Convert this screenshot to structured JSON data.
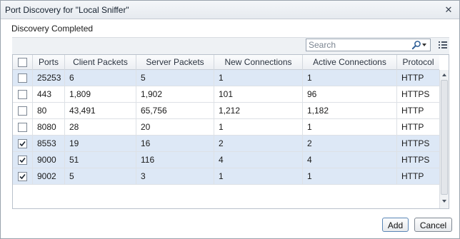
{
  "window": {
    "title": "Port Discovery for \"Local Sniffer\"",
    "close_glyph": "✕"
  },
  "status_text": "Discovery Completed",
  "toolbar": {
    "search_placeholder": "Search"
  },
  "grid": {
    "columns": [
      "Ports",
      "Client Packets",
      "Server Packets",
      "New Connections",
      "Active Connections",
      "Protocol"
    ],
    "header_checked": false,
    "rows": [
      {
        "checked": false,
        "selected": true,
        "cells": [
          "25253",
          "6",
          "5",
          "1",
          "1",
          "HTTP"
        ]
      },
      {
        "checked": false,
        "selected": false,
        "cells": [
          "443",
          "1,809",
          "1,902",
          "101",
          "96",
          "HTTPS"
        ]
      },
      {
        "checked": false,
        "selected": false,
        "cells": [
          "80",
          "43,491",
          "65,756",
          "1,212",
          "1,182",
          "HTTP"
        ]
      },
      {
        "checked": false,
        "selected": false,
        "cells": [
          "8080",
          "28",
          "20",
          "1",
          "1",
          "HTTP"
        ]
      },
      {
        "checked": true,
        "selected": true,
        "cells": [
          "8553",
          "19",
          "16",
          "2",
          "2",
          "HTTPS"
        ]
      },
      {
        "checked": true,
        "selected": true,
        "cells": [
          "9000",
          "51",
          "116",
          "4",
          "4",
          "HTTPS"
        ]
      },
      {
        "checked": true,
        "selected": true,
        "cells": [
          "9002",
          "5",
          "3",
          "1",
          "1",
          "HTTP"
        ]
      }
    ]
  },
  "buttons": {
    "add_label": "Add",
    "cancel_label": "Cancel"
  },
  "colors": {
    "selection": "#dde8f6",
    "accent": "#5a86b6"
  }
}
